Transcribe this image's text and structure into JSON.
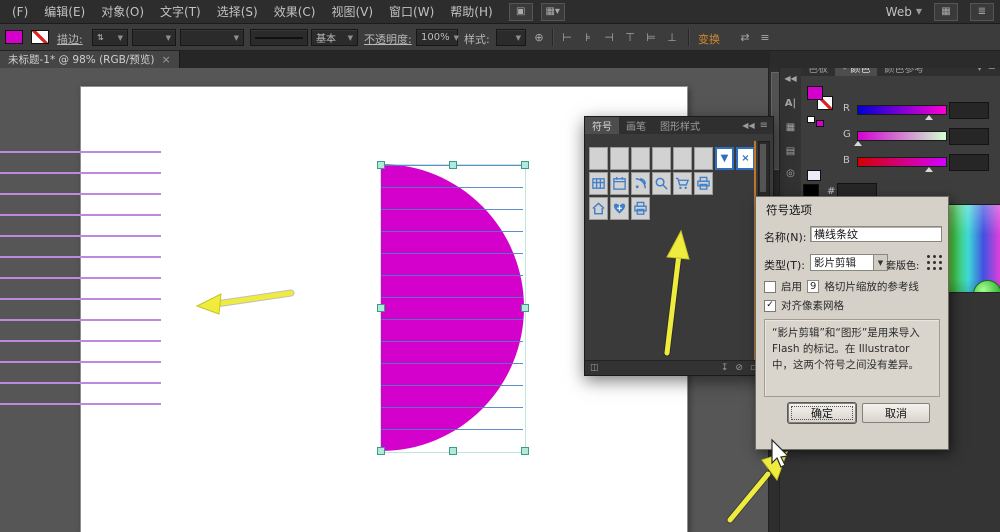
{
  "menu_bar": {
    "items": [
      "(F)",
      "编辑(E)",
      "对象(O)",
      "文字(T)",
      "选择(S)",
      "效果(C)",
      "视图(V)",
      "窗口(W)",
      "帮助(H)"
    ],
    "workspace": "Web",
    "icons": [
      "arrange-documents-icon",
      "screen-mode-icon",
      "cpu-icon",
      "menu-icon"
    ]
  },
  "control_bar": {
    "stroke_label": "描边:",
    "profile_value": "基本",
    "opacity_label": "不透明度:",
    "opacity_value": "100%",
    "style_label": "样式:",
    "transform_label": "变换",
    "transform_color": "#d0882f"
  },
  "document_tab": {
    "title": "未标题-1* @ 98% (RGB/预览)",
    "close": "×"
  },
  "symbols_panel": {
    "tabs": [
      "符号",
      "画笔",
      "图形样式"
    ],
    "thumbnails": [
      "blank",
      "blank",
      "blank",
      "blank",
      "blank",
      "blank",
      "dropdown",
      "close",
      "table",
      "calendar",
      "rss",
      "search",
      "cart",
      "printer",
      "home",
      "heart-cross",
      "printer"
    ]
  },
  "dialog": {
    "title": "符号选项",
    "name_label": "名称(N):",
    "name_value": "横线条纹",
    "type_label": "类型(T):",
    "type_value": "影片剪辑",
    "registration_label": "套版色:",
    "slice_pre": "启用",
    "slice_count": "9",
    "slice_post": "格切片缩放的参考线",
    "pixel_grid_label": "对齐像素网格",
    "pixel_grid_checked": "✓",
    "info_text": "“影片剪辑”和“图形”是用来导入 Flash 的标记。在 Illustrator 中，这两个符号之间没有差异。",
    "ok": "确定",
    "cancel": "取消"
  },
  "color_panel": {
    "tabs": [
      "色板",
      "颜色",
      "颜色参考"
    ],
    "slider_labels": [
      "R",
      "G",
      "B"
    ],
    "hex_label": "#"
  },
  "colors": {
    "fill_magenta": "#d400cc",
    "stripe_purple": "#bd89da",
    "guide_blue": "#4d7fc4",
    "selection_handle": "#b2ead9",
    "annotation_yellow": "#efec3d"
  }
}
